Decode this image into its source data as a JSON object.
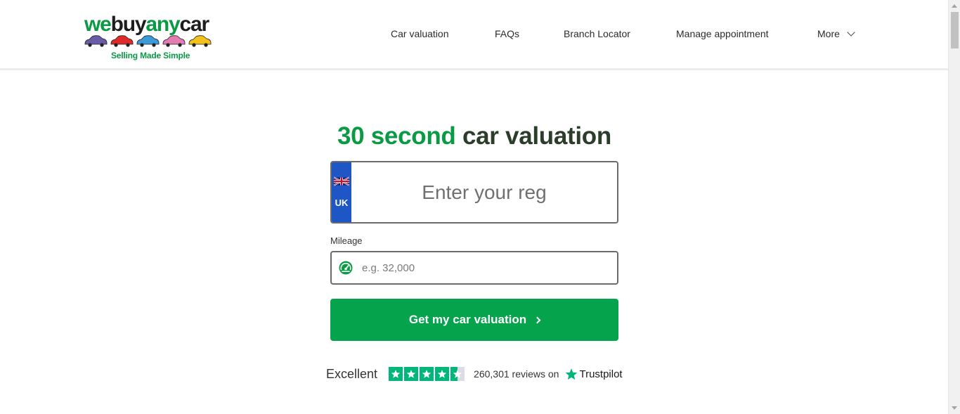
{
  "header": {
    "logo": {
      "word_parts": [
        "we",
        "buy",
        "any",
        "car"
      ],
      "tagline": "Selling Made Simple",
      "car_colors": [
        "#6a5aa8",
        "#e02a2a",
        "#3b9ad8",
        "#e57bb3",
        "#f3c21a"
      ]
    },
    "nav": [
      {
        "label": "Car valuation"
      },
      {
        "label": "FAQs"
      },
      {
        "label": "Branch Locator"
      },
      {
        "label": "Manage appointment"
      },
      {
        "label": "More",
        "icon": "chevron-down-icon"
      }
    ]
  },
  "main": {
    "title_accent": "30 second",
    "title_rest": "car valuation",
    "reg": {
      "country": "UK",
      "flag_icon": "uk-flag-icon",
      "placeholder": "Enter your reg",
      "value": ""
    },
    "mileage": {
      "label": "Mileage",
      "placeholder": "e.g. 32,000",
      "value": "",
      "icon": "speedometer-icon"
    },
    "cta": {
      "label": "Get my car valuation",
      "icon": "chevron-right-icon"
    },
    "trustpilot": {
      "rating_text": "Excellent",
      "rating_stars": 4.5,
      "reviews_text": "260,301 reviews on",
      "brand": "Trustpilot"
    }
  },
  "colors": {
    "brand_green": "#0a9a44",
    "cta_green": "#05a34b",
    "plate_blue": "#1e56c6",
    "trustpilot_green": "#00b67a"
  }
}
